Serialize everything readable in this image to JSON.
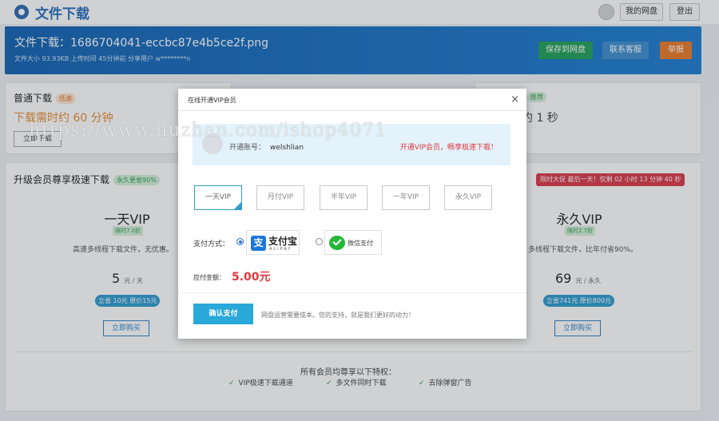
{
  "header": {
    "title": "文件下载",
    "my_disk": "我的网盘",
    "logout": "登出"
  },
  "file": {
    "title": "文件下载：1686704041-eccbc87e4b5ce2f.png",
    "meta": "文件大小 93.93KB    上传时间 45分钟前    分享用户 w********n",
    "save_btn": "保存到网盘",
    "service_btn": "联系客服",
    "report_btn": "举报"
  },
  "normal_download": {
    "title": "普通下载",
    "badge": "低速",
    "wait_text": "下载需时约 60 分钟",
    "btn": "立即下载"
  },
  "fast_download": {
    "badge": "推荐",
    "time_text": "约 1 秒"
  },
  "vip_section": {
    "title": "升级会员尊享极速下载",
    "badge": "永久更省90%",
    "promo": "限时大促 最后一天！仅剩 02 小时 13 分钟 40 秒",
    "left": {
      "name": "一天VIP",
      "tag": "限时7.0折",
      "desc": "高速多线程下载文件，无优惠。",
      "price": "5",
      "unit": "元 / 天",
      "save": "立省 10元  原价15元",
      "buy": "立即购买"
    },
    "right": {
      "name": "永久VIP",
      "tag": "限时2.7折",
      "desc": "多线程下载文件，比年付省90%。",
      "price": "69",
      "unit": "元 / 永久",
      "save": "立省741元  原价800元",
      "buy": "立即购买"
    },
    "privileges_title": "所有会员均尊享以下特权：",
    "privileges": [
      "VIP极速下载通道",
      "多文件同时下载",
      "去除弹窗广告"
    ]
  },
  "modal": {
    "title": "在线开通VIP会员",
    "close": "×",
    "account_label": "开通账号：",
    "account_name": "welshlian",
    "account_promo": "开通VIP会员，畅享极速下载！",
    "plans": [
      "一天VIP",
      "月付VIP",
      "半年VIP",
      "一年VIP",
      "永久VIP"
    ],
    "pay_label": "支付方式：",
    "alipay_name": "支付宝",
    "alipay_sub": "ALIPAY",
    "wechat_name": "微信支付",
    "amount_label": "应付金额：",
    "amount": "5.00元",
    "confirm": "确认支付",
    "note": "网盘运营需要成本。您的支持，就是我们更好的动力！"
  },
  "watermark": "https://www.huzhan.com/ishop4071"
}
